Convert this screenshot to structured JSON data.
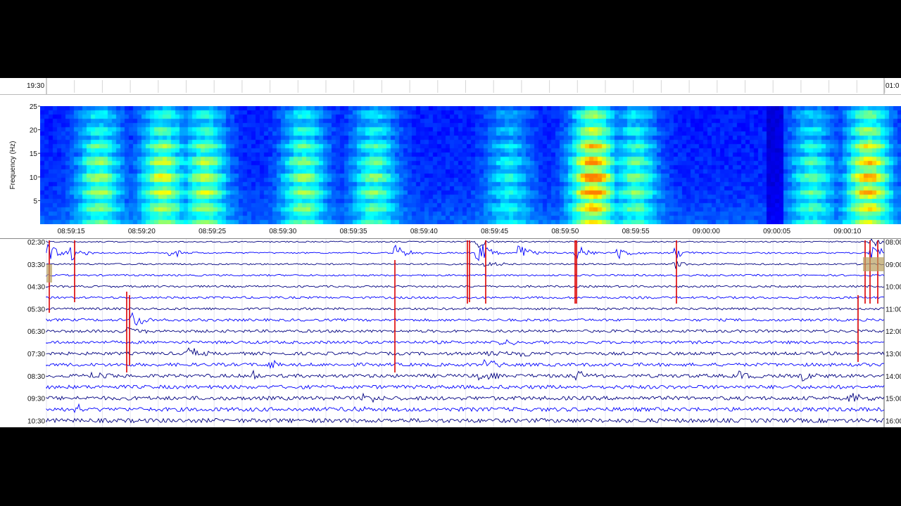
{
  "top_strip": {
    "left_time": "19:30",
    "right_time": "01:0"
  },
  "chart_data": [
    {
      "type": "heatmap",
      "name": "spectrogram",
      "ylabel": "Frequency (Hz)",
      "ylim": [
        0,
        25
      ],
      "yticks": [
        5,
        10,
        15,
        20,
        25
      ],
      "x_tick_labels": [
        "08:59:15",
        "08:59:20",
        "08:59:25",
        "08:59:30",
        "08:59:35",
        "08:59:40",
        "08:59:45",
        "08:59:50",
        "08:59:55",
        "09:00:00",
        "09:00:05",
        "09:00:10"
      ],
      "colormap": [
        "#00007f",
        "#0000ff",
        "#007fff",
        "#00ffff",
        "#7fff7f",
        "#ffff00",
        "#ff7f00"
      ],
      "bursts": [
        {
          "t": 2,
          "intensity": 0.55
        },
        {
          "t": 6.5,
          "intensity": 0.65
        },
        {
          "t": 9.5,
          "intensity": 0.6
        },
        {
          "t": 16.5,
          "intensity": 0.55
        },
        {
          "t": 21.5,
          "intensity": 0.5
        },
        {
          "t": 31,
          "intensity": 0.35
        },
        {
          "t": 37,
          "intensity": 0.9
        },
        {
          "t": 40,
          "intensity": 0.5
        },
        {
          "t": 52.5,
          "intensity": 0.45
        },
        {
          "t": 56.5,
          "intensity": 0.8
        }
      ]
    },
    {
      "type": "line",
      "name": "helicorder",
      "left_labels": [
        "02:30",
        "03:30",
        "04:30",
        "05:30",
        "06:30",
        "07:30",
        "08:30",
        "09:30",
        "10:30"
      ],
      "right_labels": [
        "08:00",
        "09:00",
        "10:00",
        "11:00",
        "12:00",
        "13:00",
        "14:00",
        "15:00",
        "16:00"
      ],
      "trace_colors": [
        "#000080",
        "#0000ff",
        "#000080",
        "#0000ff"
      ],
      "event_color": "#dd0000",
      "num_traces": 17
    }
  ]
}
